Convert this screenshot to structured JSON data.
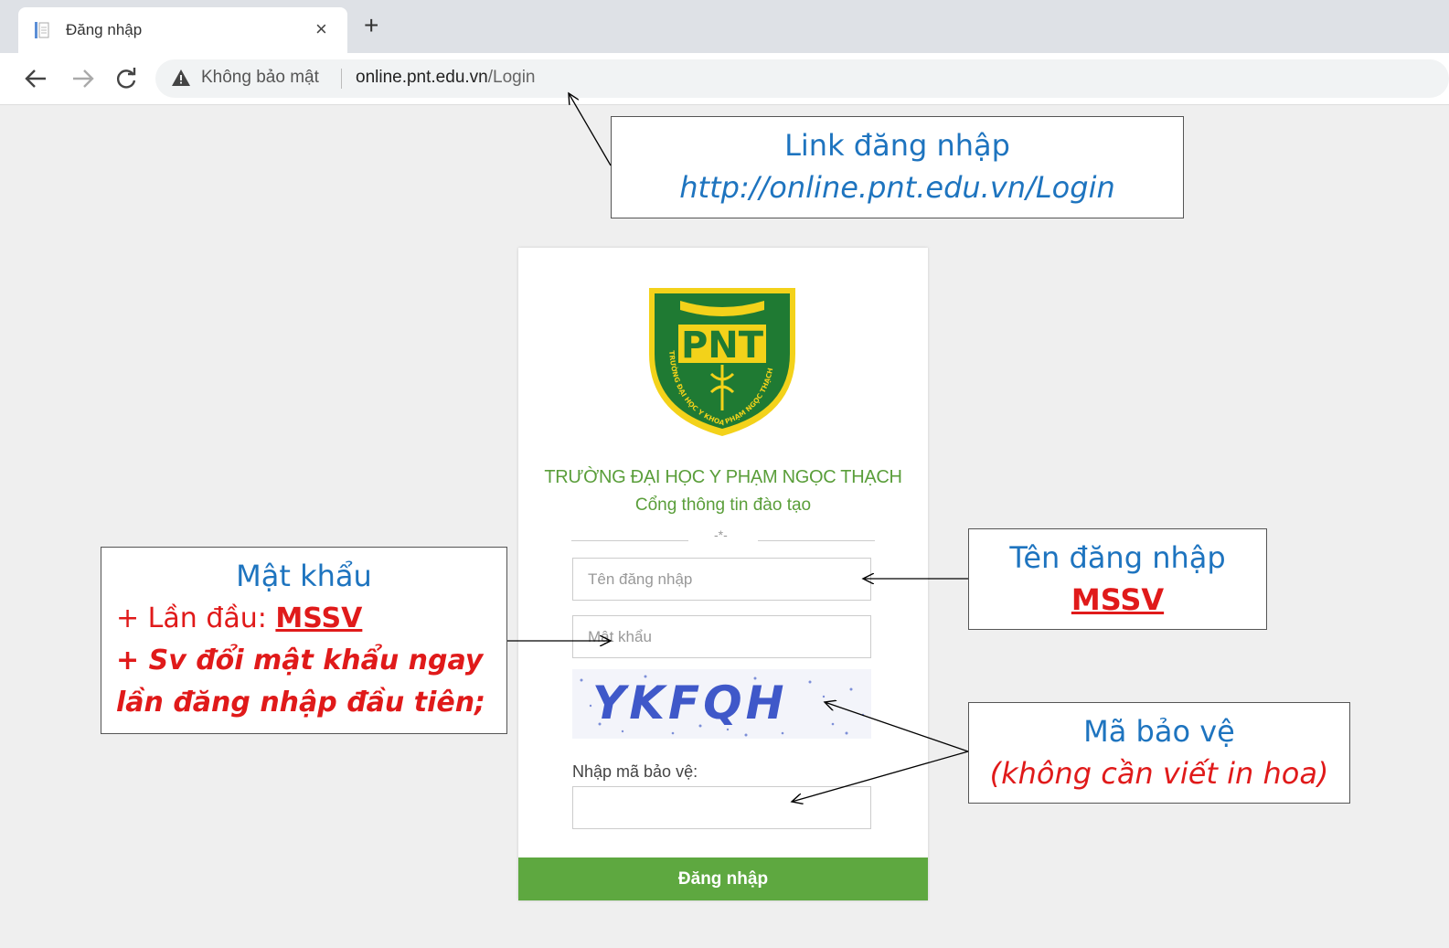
{
  "browser": {
    "tab_title": "Đăng nhập",
    "close_glyph": "×",
    "newtab_glyph": "+",
    "not_secure": "Không bảo mật",
    "url_host": "online.pnt.edu.vn",
    "url_path": "/Login"
  },
  "login": {
    "logo_text": "PNT",
    "logo_ring_text": "TRƯỜNG ĐẠI HỌC Y KHOA PHẠM NGỌC THẠCH",
    "school_name": "TRƯỜNG ĐẠI HỌC Y PHẠM NGỌC THẠCH",
    "portal_name": "Cổng thông tin đào tạo",
    "divider_glyph": "-*-",
    "username_placeholder": "Tên đăng nhập",
    "password_placeholder": "Mật khẩu",
    "captcha_text": "YKFQH",
    "captcha_label": "Nhập mã bảo vệ:",
    "submit_label": "Đăng nhập"
  },
  "annotations": {
    "link": {
      "title": "Link đăng nhập",
      "url": "http://online.pnt.edu.vn/Login"
    },
    "username": {
      "title": "Tên đăng nhập",
      "value": "MSSV"
    },
    "password": {
      "title": "Mật khẩu",
      "first_prefix": "+ Lần đầu: ",
      "first_value": "MSSV",
      "note_line1": "+ Sv đổi mật khẩu ngay",
      "note_line2": "lần đăng nhập đầu tiên;"
    },
    "captcha": {
      "title": "Mã bảo vệ",
      "note": "(không cần viết in hoa)"
    }
  },
  "colors": {
    "brand_green": "#5ea840",
    "annotation_blue": "#1e74bf",
    "annotation_red": "#e01a1a",
    "captcha_blue": "#3f58c9"
  }
}
